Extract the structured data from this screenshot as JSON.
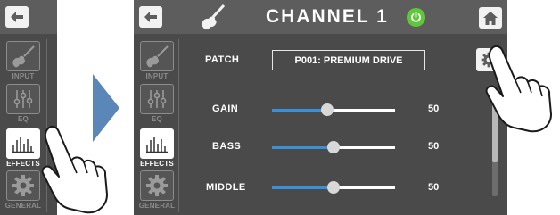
{
  "left_screen": {
    "sidebar": {
      "items": [
        {
          "label": "INPUT",
          "icon": "guitar-icon",
          "active": false
        },
        {
          "label": "EQ",
          "icon": "eq-sliders-icon",
          "active": false
        },
        {
          "label": "EFFECTS",
          "icon": "effects-bars-icon",
          "active": true
        },
        {
          "label": "GENERAL",
          "icon": "gear-icon",
          "active": false
        }
      ]
    }
  },
  "right_screen": {
    "header": {
      "title": "CHANNEL 1"
    },
    "sidebar": {
      "items": [
        {
          "label": "INPUT",
          "icon": "guitar-icon",
          "active": false
        },
        {
          "label": "EQ",
          "icon": "eq-sliders-icon",
          "active": false
        },
        {
          "label": "EFFECTS",
          "icon": "effects-bars-icon",
          "active": true
        },
        {
          "label": "GENERAL",
          "icon": "gear-icon",
          "active": false
        }
      ]
    },
    "patch": {
      "label": "PATCH",
      "value": "P001: PREMIUM DRIVE"
    },
    "sliders": [
      {
        "label": "GAIN",
        "value": "50",
        "level": 0.45
      },
      {
        "label": "BASS",
        "value": "50",
        "level": 0.5
      },
      {
        "label": "MIDDLE",
        "value": "50",
        "level": 0.5
      }
    ]
  },
  "colors": {
    "background": "#4a4a4a",
    "topbar": "#5d5d5d",
    "accent_blue": "#3a8fd6",
    "power_green": "#5fc83a",
    "arrow_blue": "#5b86b8"
  }
}
